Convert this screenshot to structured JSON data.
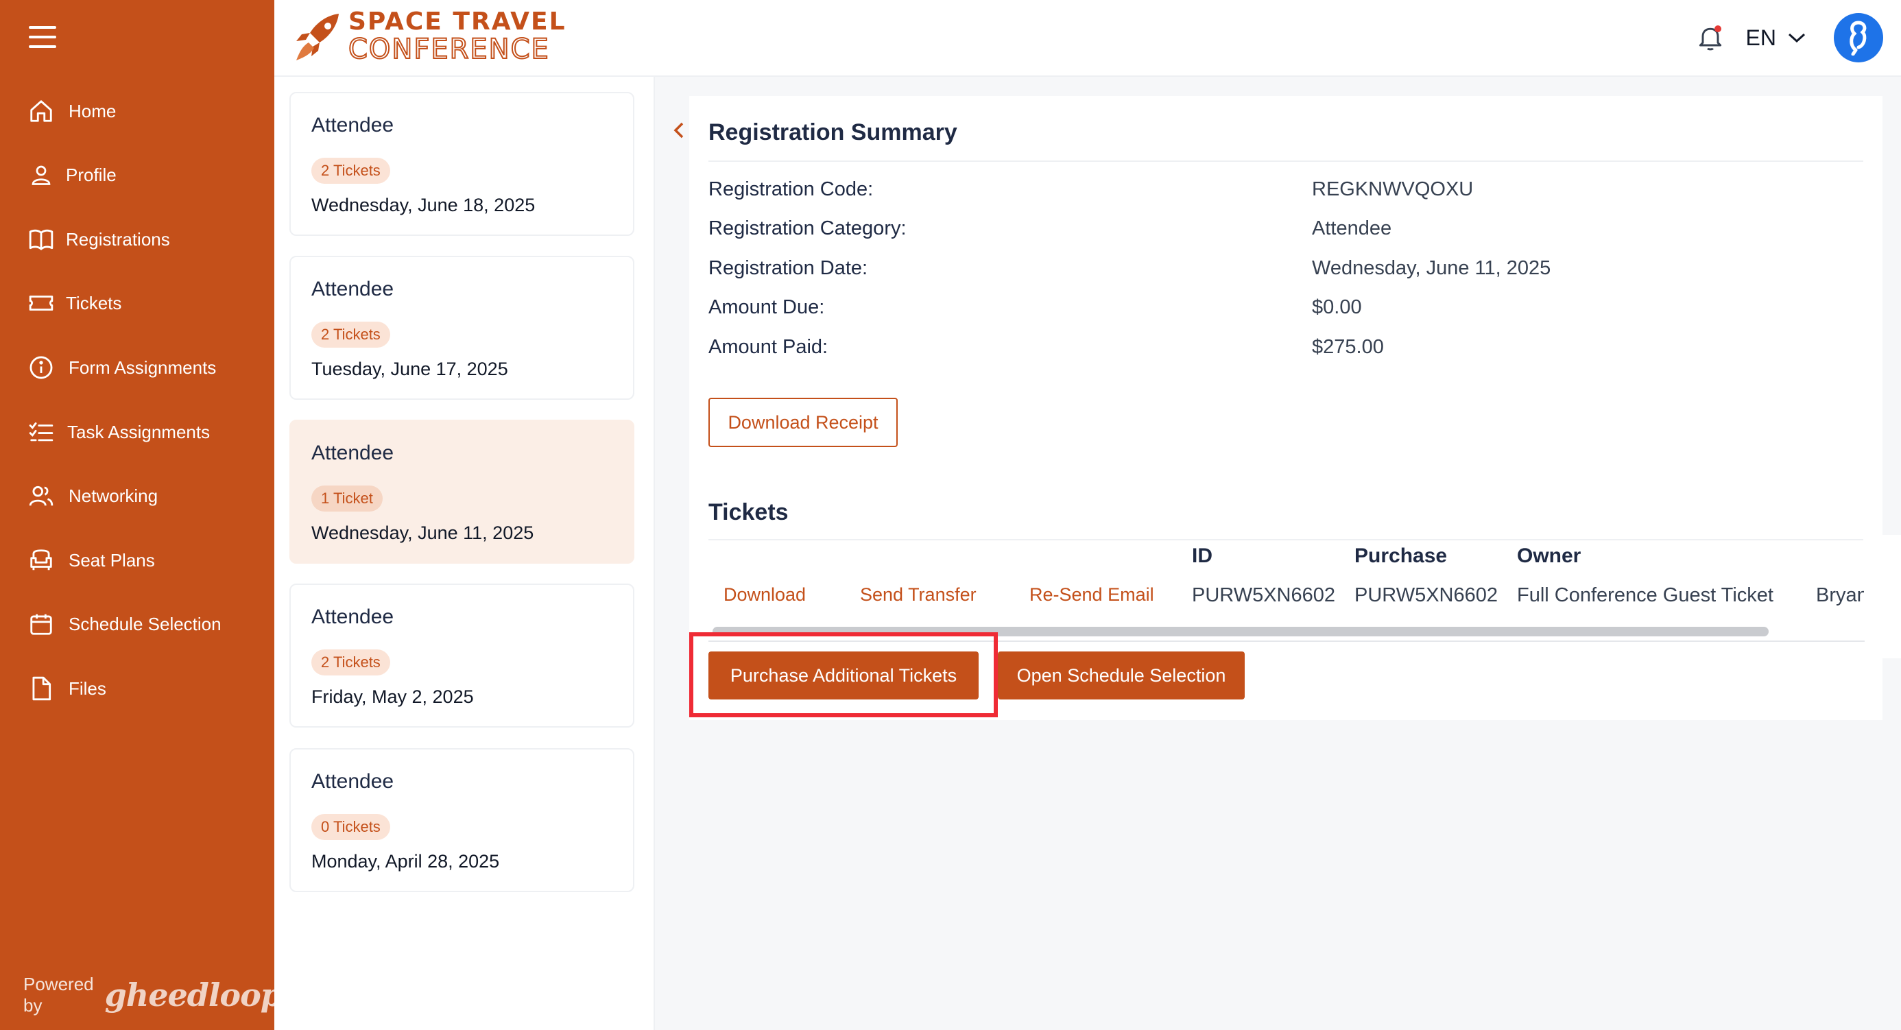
{
  "sidebar": {
    "items": [
      {
        "label": "Home",
        "icon": "home-icon"
      },
      {
        "label": "Profile",
        "icon": "user-icon"
      },
      {
        "label": "Registrations",
        "icon": "book-icon"
      },
      {
        "label": "Tickets",
        "icon": "ticket-icon"
      },
      {
        "label": "Form Assignments",
        "icon": "info-icon"
      },
      {
        "label": "Task Assignments",
        "icon": "checklist-icon"
      },
      {
        "label": "Networking",
        "icon": "users-icon"
      },
      {
        "label": "Seat Plans",
        "icon": "armchair-icon"
      },
      {
        "label": "Schedule Selection",
        "icon": "calendar-icon"
      },
      {
        "label": "Files",
        "icon": "file-icon"
      }
    ],
    "powered_by": "Powered by",
    "powered_logo": "gheedloop"
  },
  "header": {
    "logo_line1": "SPACE TRAVEL",
    "logo_line2": "CONFERENCE",
    "language": "EN"
  },
  "registrations": [
    {
      "category": "Attendee",
      "tickets": "2 Tickets",
      "date": "Wednesday, June 18, 2025"
    },
    {
      "category": "Attendee",
      "tickets": "2 Tickets",
      "date": "Tuesday, June 17, 2025"
    },
    {
      "category": "Attendee",
      "tickets": "1 Ticket",
      "date": "Wednesday, June 11, 2025"
    },
    {
      "category": "Attendee",
      "tickets": "2 Tickets",
      "date": "Friday, May 2, 2025"
    },
    {
      "category": "Attendee",
      "tickets": "0 Tickets",
      "date": "Monday, April 28, 2025"
    }
  ],
  "summary": {
    "title": "Registration Summary",
    "rows": [
      {
        "label": "Registration Code:",
        "value": "REGKNWVQOXU"
      },
      {
        "label": "Registration Category:",
        "value": "Attendee"
      },
      {
        "label": "Registration Date:",
        "value": "Wednesday, June 11, 2025"
      },
      {
        "label": "Amount Due:",
        "value": "$0.00"
      },
      {
        "label": "Amount Paid:",
        "value": "$275.00"
      }
    ],
    "download_receipt": "Download Receipt"
  },
  "tickets": {
    "title": "Tickets",
    "headers": {
      "id": "ID",
      "purchase": "Purchase",
      "owner": "Owner"
    },
    "row": {
      "download": "Download",
      "send_transfer": "Send Transfer",
      "resend_email": "Re-Send Email",
      "id": "PURW5XN6602",
      "purchase": "PURW5XN6602",
      "ticket_type": "Full Conference Guest Ticket",
      "owner": "Bryan"
    },
    "purchase_additional": "Purchase Additional Tickets",
    "open_schedule": "Open Schedule Selection"
  },
  "colors": {
    "brand": "#c4501a",
    "highlight": "#ef2b35",
    "avatar": "#1e73e8"
  }
}
